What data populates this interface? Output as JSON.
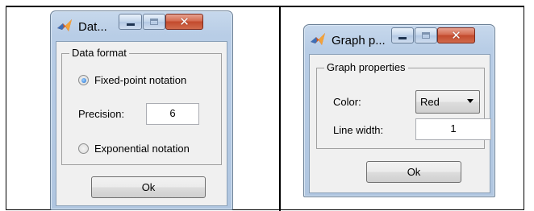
{
  "dialogs": [
    {
      "title": "Dat...",
      "group_label": "Data format",
      "fixed_label": "Fixed-point notation",
      "precision_label": "Precision:",
      "precision_value": "6",
      "exponential_label": "Exponential notation",
      "ok_label": "Ok",
      "selected": "fixed-point"
    },
    {
      "title": "Graph p...",
      "group_label": "Graph properties",
      "color_label": "Color:",
      "color_value": "Red",
      "linewidth_label": "Line width:",
      "linewidth_value": "1",
      "ok_label": "Ok"
    }
  ],
  "icons": {
    "app": "matlab-icon",
    "minimize": "minimize-icon",
    "maximize": "maximize-icon",
    "close": "close-icon",
    "dropdown": "chevron-down-icon"
  },
  "colors": {
    "titlebar": "#b8cde6",
    "close_button": "#c24a2d",
    "radio_selected": "#1f6fcf"
  }
}
